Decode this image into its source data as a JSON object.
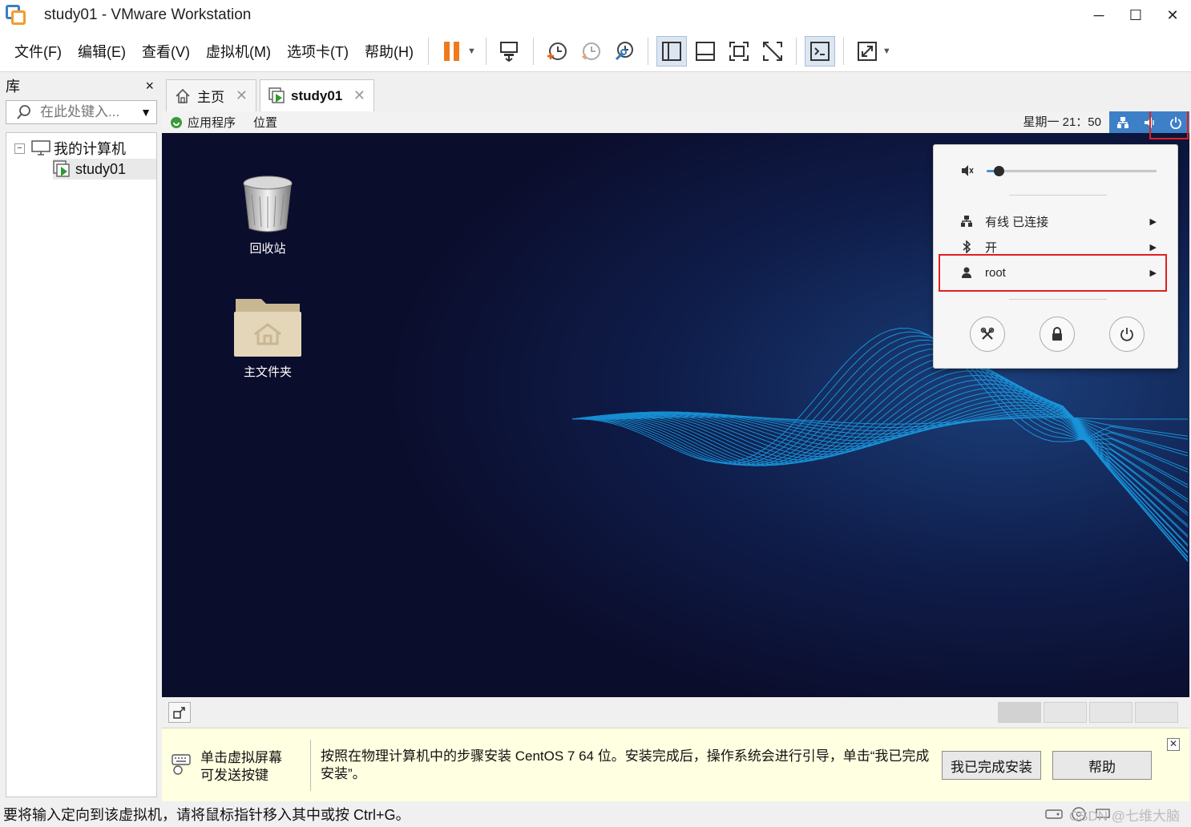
{
  "window": {
    "title": "study01 - VMware Workstation",
    "minimize": "─",
    "maximize": "☐",
    "close": "✕"
  },
  "menu": [
    "文件(F)",
    "编辑(E)",
    "查看(V)",
    "虚拟机(M)",
    "选项卡(T)",
    "帮助(H)"
  ],
  "library": {
    "title": "库",
    "close": "×",
    "search_placeholder": "在此处键入...",
    "tree_root": "我的计算机",
    "tree_child": "study01",
    "toggle": "−"
  },
  "tabs": [
    {
      "label": "主页",
      "close": "✕"
    },
    {
      "label": "study01",
      "close": "✕"
    }
  ],
  "guest": {
    "topbar": {
      "apps": "应用程序",
      "places": "位置",
      "clock": "星期一 21：50"
    },
    "desktop_icons": [
      {
        "label": "回收站"
      },
      {
        "label": "主文件夹"
      }
    ],
    "system_menu": {
      "volume_fraction": 0.05,
      "wired": "有线 已连接",
      "bluetooth": "开",
      "user": "root"
    },
    "colors": {
      "highlight": "#e02020",
      "wave": "#19b4ff",
      "panel_blue": "#3d80c8"
    }
  },
  "infobar": {
    "hint": "单击虚拟屏幕 可发送按键",
    "message": "按照在物理计算机中的步骤安装 CentOS 7 64 位。安装完成后，操作系统会进行引导，单击“我已完成安装”。",
    "done_button": "我已完成安装",
    "help_button": "帮助",
    "close": "✕"
  },
  "statusbar": {
    "message": "要将输入定向到该虚拟机，请将鼠标指针移入其中或按 Ctrl+G。",
    "watermark": "CSDN @七维大脑"
  }
}
